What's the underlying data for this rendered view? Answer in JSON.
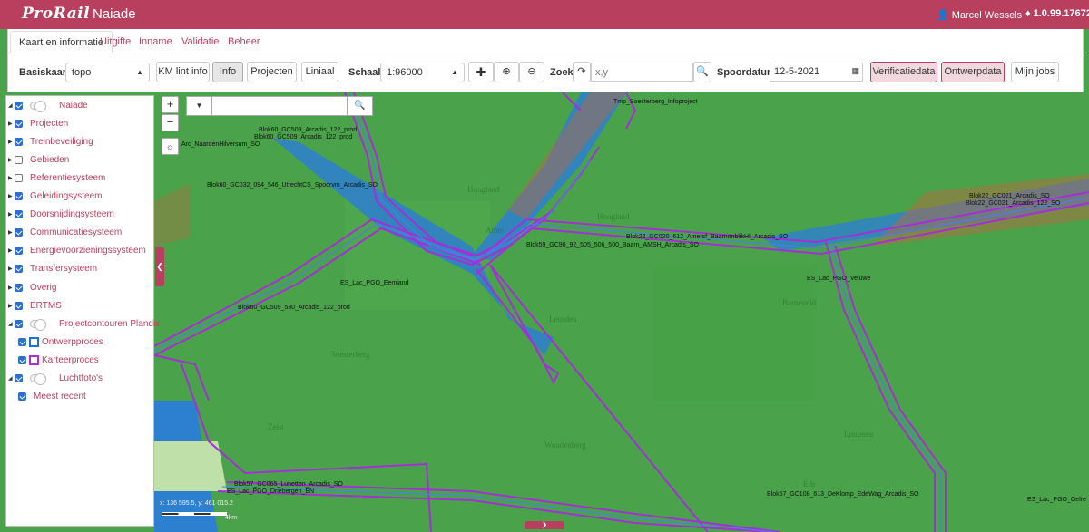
{
  "app": {
    "logo": "ProRail",
    "name": "Naiade",
    "user": "Marcel Wessels",
    "version": "1.0.99.17672"
  },
  "tabs": [
    "Kaart en informatie",
    "Uitgifte",
    "Inname",
    "Validatie",
    "Beheer"
  ],
  "toolbar": {
    "basiskaart_label": "Basiskaart:",
    "basiskaart_value": "topo",
    "km_lint_info": "KM lint info",
    "info": "Info",
    "projecten": "Projecten",
    "liniaal": "Liniaal",
    "schaal_label": "Schaal:",
    "schaal_value": "1:96000",
    "zoek_label": "Zoek:",
    "zoek_placeholder": "x,y",
    "spoordatum_label": "Spoordatum:",
    "spoordatum_value": "12-5-2021",
    "verificatiedata": "Verificatiedata",
    "ontwerpdata": "Ontwerpdata",
    "mijn_jobs": "Mijn jobs"
  },
  "layers": [
    {
      "label": "Naiade",
      "level": 0,
      "expanded": true,
      "checked": true,
      "toggle": true
    },
    {
      "label": "Projecten",
      "level": 1,
      "checked": true
    },
    {
      "label": "Treinbeveiliging",
      "level": 1,
      "checked": true
    },
    {
      "label": "Gebieden",
      "level": 1,
      "checked": false
    },
    {
      "label": "Referentiesysteem",
      "level": 1,
      "checked": false
    },
    {
      "label": "Geleidingsysteem",
      "level": 1,
      "checked": true
    },
    {
      "label": "Doorsnijdingsysteem",
      "level": 1,
      "checked": true
    },
    {
      "label": "Communicatiesysteem",
      "level": 1,
      "checked": true
    },
    {
      "label": "Energievoorzieningssysteem",
      "level": 1,
      "checked": true
    },
    {
      "label": "Transfersysteem",
      "level": 1,
      "checked": true
    },
    {
      "label": "Overig",
      "level": 1,
      "checked": true
    },
    {
      "label": "ERTMS",
      "level": 1,
      "checked": true
    },
    {
      "label": "Projectcontouren Plandix",
      "level": 0,
      "expanded": true,
      "checked": true,
      "toggle": true
    },
    {
      "label": "Ontwerpproces",
      "level": 2,
      "checked": true,
      "swatch": "#1e6fd9"
    },
    {
      "label": "Karteerproces",
      "level": 2,
      "checked": true,
      "swatch": "#b02fd0"
    },
    {
      "label": "Luchtfoto's",
      "level": 0,
      "expanded": true,
      "checked": true,
      "toggle": true
    },
    {
      "label": "Meest recent",
      "level": 2,
      "checked": true
    }
  ],
  "map_labels": [
    "Blok60_GC509_Arcadis_122_prod",
    "Blok60_GC509_Arcadis_122_prod",
    "Arc_NaardenHilversum_SO",
    "Blok60_GC032_094_546_UtrechtCS_Spoorvm_Arcadis_SO",
    "Blok59_GC98_92_505_506_500_Baarn_AMSH_Arcadis_SO",
    "Blok22_GC020_612_Amersf_BaarnonblikHI_Arcadis_SO",
    "Blok22_GC021_Arcadis_SO",
    "Blok22_GC021_Arcadis_122_SO",
    "ES_Lac_PGO_Eemland",
    "Blok60_GC509_530_Arcadis_122_prod",
    "ES_Lac_PGO_Veluwe",
    "Blok57_GC065_Lunetten_Arcadis_SO",
    "ES_Lac_PGO_Driebergen_EN",
    "Blok57_GC108_613_DeKlomp_EdeWag_Arcadis_SO",
    "ES_Lac_PGO_Gelre",
    "Tmp_Soesterberg_Infoproject"
  ],
  "map": {
    "coords": "x: 136 595.5, y: 461 015.2",
    "scale": "4km"
  },
  "colors": {
    "brand": "#b8405e",
    "map_green": "#4aa34a",
    "water_blue": "#2d7fd0",
    "contour_purple": "#a42fd6"
  }
}
